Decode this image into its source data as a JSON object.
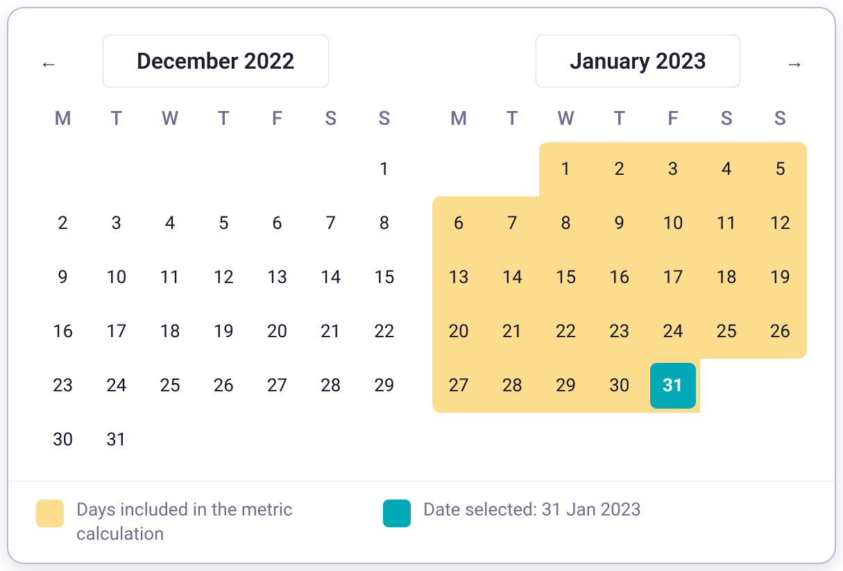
{
  "colors": {
    "included": "#fcdd8e",
    "selected": "#00a9b5",
    "text": "#14142B",
    "muted": "#6f6c90"
  },
  "weekdays": [
    "M",
    "T",
    "W",
    "T",
    "F",
    "S",
    "S"
  ],
  "months": {
    "left": {
      "title": "December 2022",
      "leadingBlanks": 6,
      "daysInMonth": 31,
      "includedDays": [],
      "selectedDay": null
    },
    "right": {
      "title": "January 2023",
      "leadingBlanks": 2,
      "daysInMonth": 31,
      "includedDays": [
        1,
        2,
        3,
        4,
        5,
        6,
        7,
        8,
        9,
        10,
        11,
        12,
        13,
        14,
        15,
        16,
        17,
        18,
        19,
        20,
        21,
        22,
        23,
        24,
        25,
        26,
        27,
        28,
        29,
        30,
        31
      ],
      "selectedDay": 31
    }
  },
  "legend": {
    "included": "Days included in the metric calculation",
    "selected": "Date selected: 31 Jan 2023"
  },
  "nav": {
    "prev": "←",
    "next": "→"
  }
}
